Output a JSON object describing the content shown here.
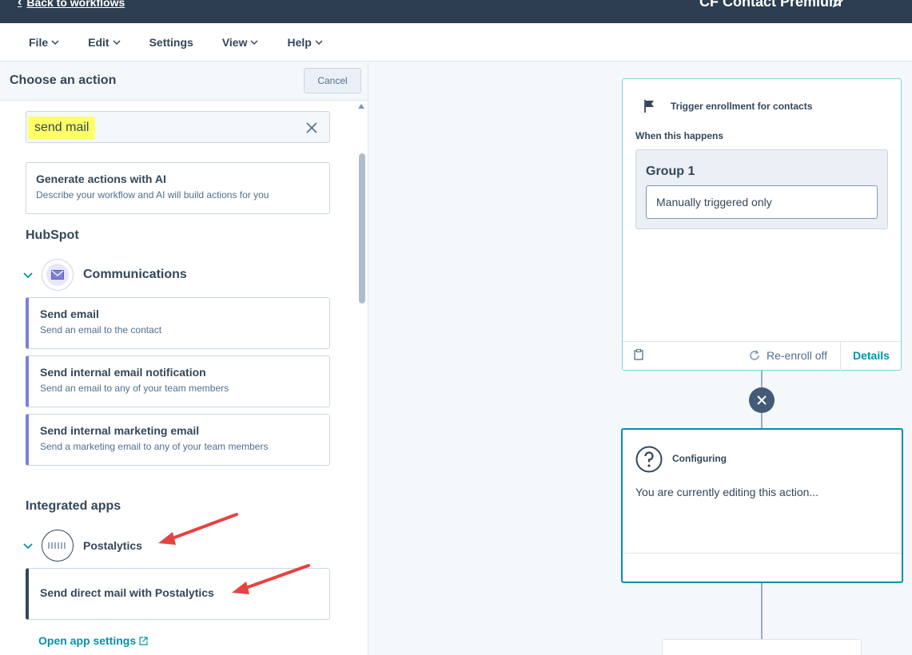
{
  "header": {
    "back_label": "Back to workflows",
    "workflow_title": "CF Contact Premium"
  },
  "menu": {
    "file": "File",
    "edit": "Edit",
    "settings": "Settings",
    "view": "View",
    "help": "Help"
  },
  "panel": {
    "title": "Choose an action",
    "cancel_label": "Cancel",
    "search_value": "send mail",
    "ai_card": {
      "title": "Generate actions with AI",
      "subtitle": "Describe your workflow and AI will build actions for you"
    },
    "hubspot_label": "HubSpot",
    "communications": {
      "label": "Communications",
      "actions": [
        {
          "title": "Send email",
          "subtitle": "Send an email to the contact"
        },
        {
          "title": "Send internal email notification",
          "subtitle": "Send an email to any of your team members"
        },
        {
          "title": "Send internal marketing email",
          "subtitle": "Send a marketing email to any of your team members"
        }
      ]
    },
    "integrated_label": "Integrated apps",
    "postalytics": {
      "label": "Postalytics",
      "action_title": "Send direct mail with Postalytics",
      "open_settings": "Open app settings"
    }
  },
  "canvas": {
    "trigger": {
      "title": "Trigger enrollment for contacts",
      "when_label": "When this happens",
      "group_title": "Group 1",
      "group_value": "Manually triggered only",
      "reenroll": "Re-enroll off",
      "details": "Details"
    },
    "config": {
      "title": "Configuring",
      "text": "You are currently editing this action..."
    }
  },
  "colors": {
    "header_bg": "#2d3e50",
    "accent": "#0091ae",
    "highlight": "#ffff66",
    "comm_border": "#7b7fd9",
    "annotation_arrow": "#e8423f"
  }
}
